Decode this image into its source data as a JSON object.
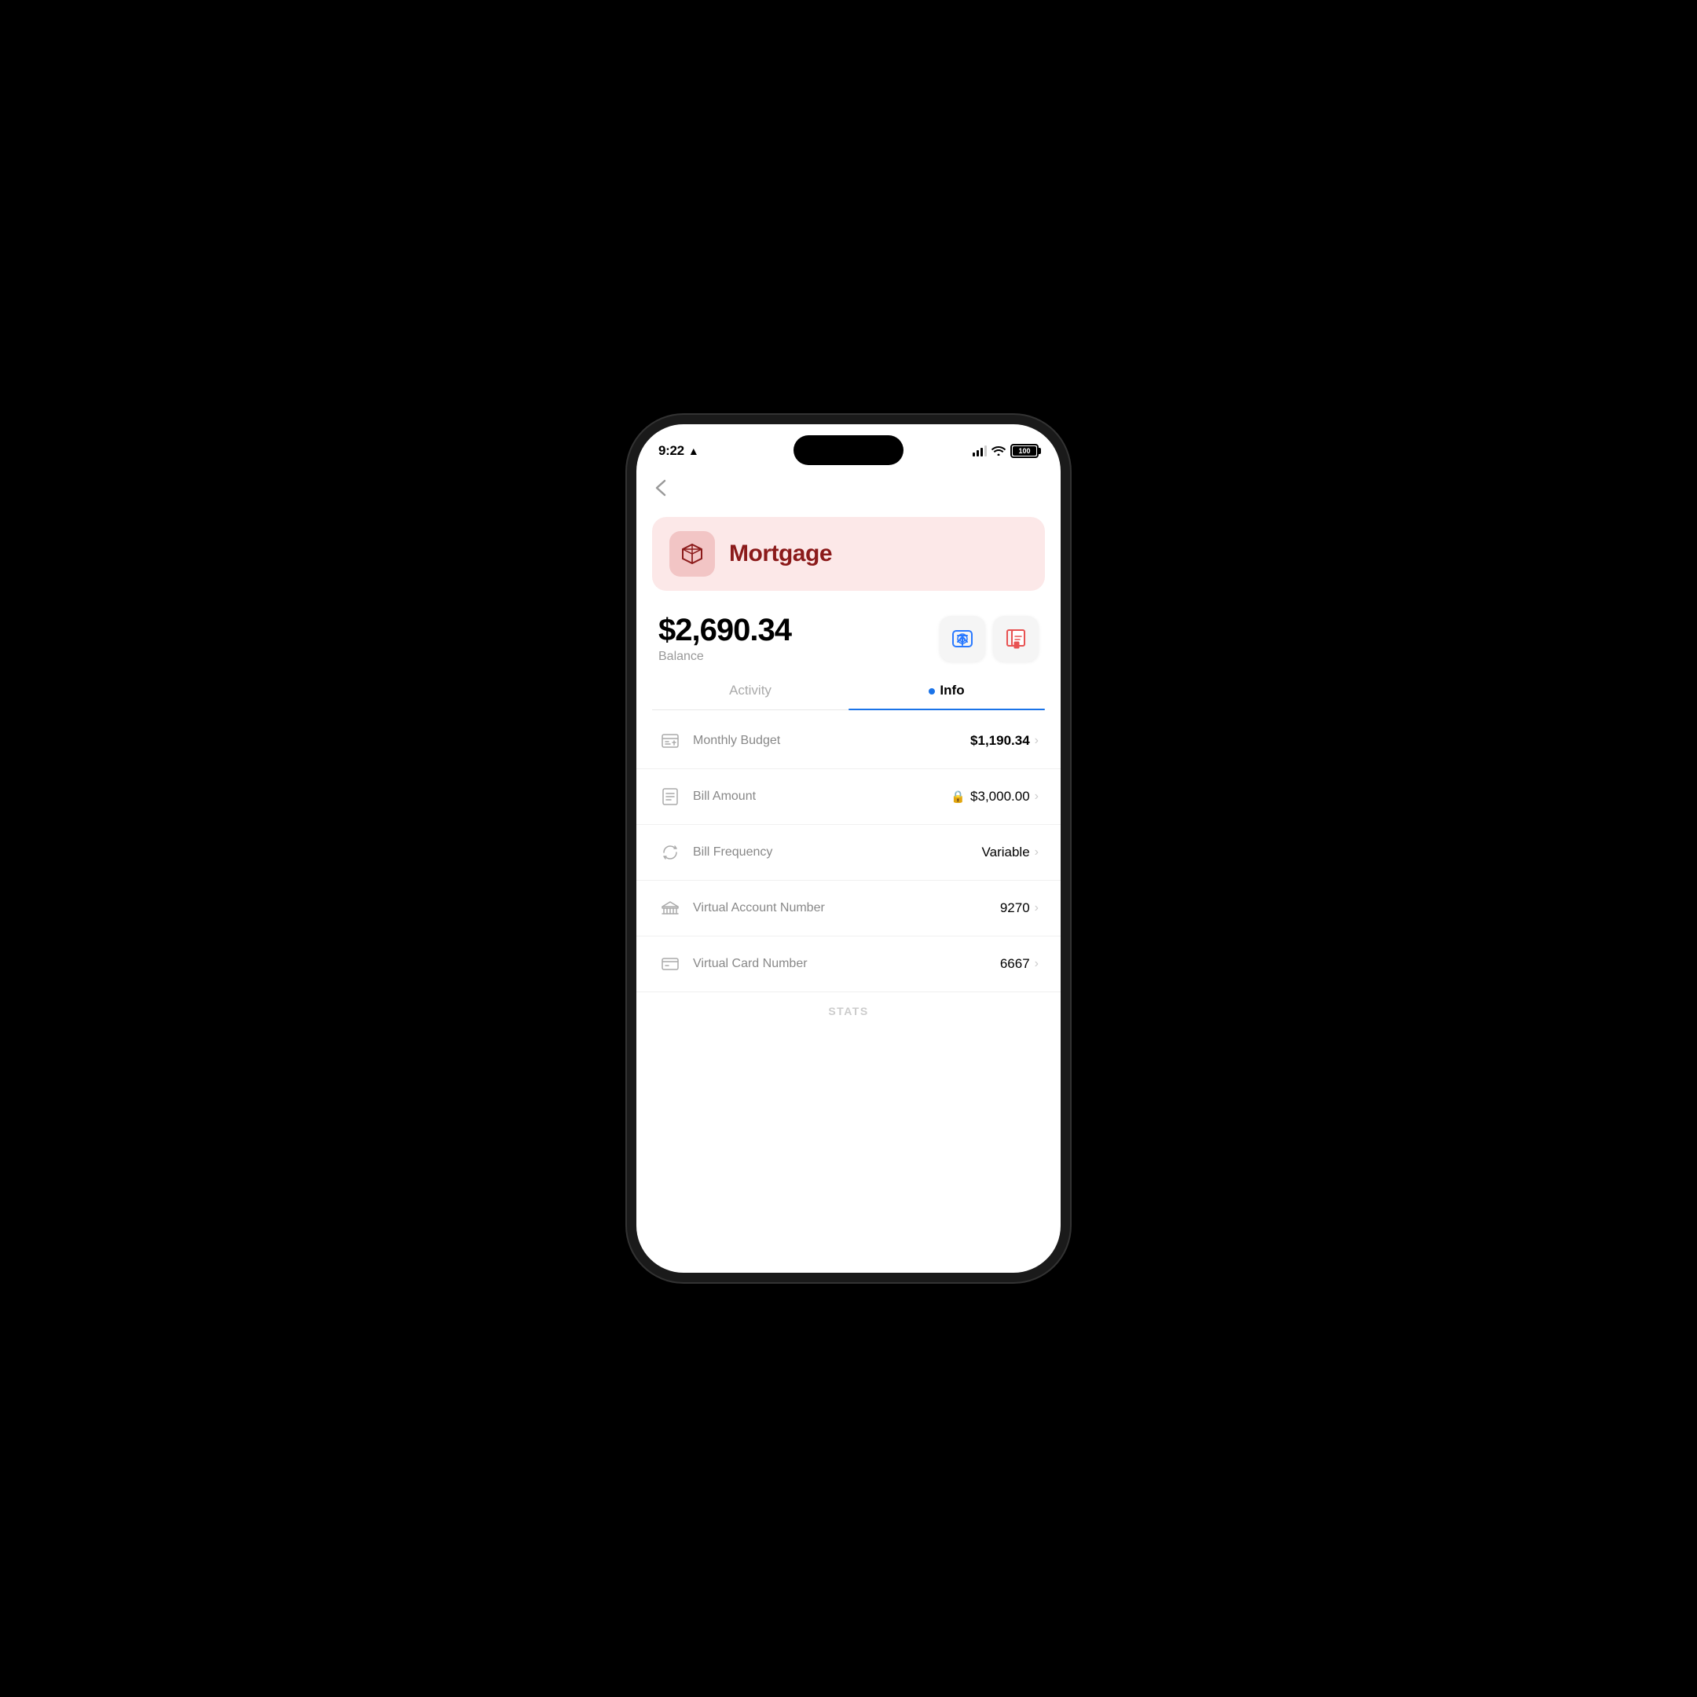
{
  "status_bar": {
    "time": "9:22",
    "battery": "100"
  },
  "nav": {
    "back_label": "‹"
  },
  "account": {
    "name": "Mortgage",
    "icon": "cube"
  },
  "balance": {
    "amount": "$2,690.34",
    "label": "Balance"
  },
  "action_buttons": [
    {
      "id": "transfer",
      "label": "Transfer"
    },
    {
      "id": "statements",
      "label": "Statements"
    }
  ],
  "tabs": [
    {
      "id": "activity",
      "label": "Activity",
      "active": false
    },
    {
      "id": "info",
      "label": "Info",
      "active": true
    }
  ],
  "info_rows": [
    {
      "id": "monthly-budget",
      "label": "Monthly Budget",
      "value": "$1,190.34",
      "bold": true,
      "locked": false,
      "icon": "budget"
    },
    {
      "id": "bill-amount",
      "label": "Bill Amount",
      "value": "$3,000.00",
      "bold": false,
      "locked": true,
      "icon": "bill"
    },
    {
      "id": "bill-frequency",
      "label": "Bill Frequency",
      "value": "Variable",
      "bold": false,
      "locked": false,
      "icon": "frequency"
    },
    {
      "id": "virtual-account",
      "label": "Virtual Account Number",
      "value": "9270",
      "bold": false,
      "locked": false,
      "icon": "bank"
    },
    {
      "id": "virtual-card",
      "label": "Virtual Card Number",
      "value": "6667",
      "bold": false,
      "locked": false,
      "icon": "card"
    }
  ],
  "stats_label": "STATS"
}
